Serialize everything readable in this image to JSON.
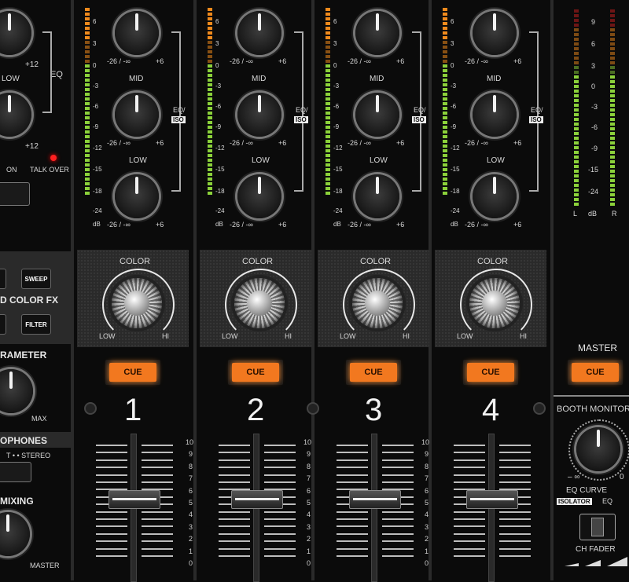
{
  "left_section": {
    "knob_plus12_a": "+12",
    "low_label": "LOW",
    "eq_label": "EQ",
    "knob_plus12_b": "+12",
    "on_label": "ON",
    "talkover_label": "TALK OVER",
    "sweep_button": "SWEEP",
    "color_fx_label": "D COLOR FX",
    "filter_button": "FILTER",
    "parameter_label": "RAMETER",
    "max_label": "MAX",
    "headphones_label": "OPHONES",
    "stereo_label": "T • • STEREO",
    "mixing_label": "MIXING",
    "master_small_label": "MASTER"
  },
  "channels": [
    {
      "num": "1",
      "cue": "CUE",
      "mid": "MID",
      "low": "LOW",
      "range": "-26 / -∞",
      "plus": "+6",
      "eq_iso": "EQ/",
      "iso": "ISO",
      "color": "COLOR",
      "color_low": "LOW",
      "color_hi": "HI"
    },
    {
      "num": "2",
      "cue": "CUE",
      "mid": "MID",
      "low": "LOW",
      "range": "-26 / -∞",
      "plus": "+6",
      "eq_iso": "EQ/",
      "iso": "ISO",
      "color": "COLOR",
      "color_low": "LOW",
      "color_hi": "HI"
    },
    {
      "num": "3",
      "cue": "CUE",
      "mid": "MID",
      "low": "LOW",
      "range": "-26 / -∞",
      "plus": "+6",
      "eq_iso": "EQ/",
      "iso": "ISO",
      "color": "COLOR",
      "color_low": "LOW",
      "color_hi": "HI"
    },
    {
      "num": "4",
      "cue": "CUE",
      "mid": "MID",
      "low": "LOW",
      "range": "-26 / -∞",
      "plus": "+6",
      "eq_iso": "EQ/",
      "iso": "ISO",
      "color": "COLOR",
      "color_low": "LOW",
      "color_hi": "HI"
    }
  ],
  "meter_scale": [
    "6",
    "3",
    "0",
    "-3",
    "-6",
    "-9",
    "-12",
    "-15",
    "-18",
    "-24",
    "dB"
  ],
  "fader_scale": [
    "10",
    "9",
    "8",
    "7",
    "6",
    "5",
    "4",
    "3",
    "2",
    "1",
    "0"
  ],
  "master": {
    "meter_scale": [
      "9",
      "6",
      "3",
      "0",
      "-3",
      "-6",
      "-9",
      "-15",
      "-24"
    ],
    "l": "L",
    "db": "dB",
    "r": "R",
    "label": "MASTER",
    "cue": "CUE",
    "booth_monitor": "BOOTH MONITOR",
    "booth_min": "– ∞",
    "booth_max": "0",
    "eq_curve": "EQ CURVE",
    "isolator": "ISOLATOR",
    "eq": "EQ",
    "ch_fader": "CH FADER"
  },
  "colors": {
    "cue_orange": "#f2781f",
    "meter_green": "#8bd13a",
    "meter_orange": "#f08a1c",
    "led_red": "#ff2020"
  }
}
